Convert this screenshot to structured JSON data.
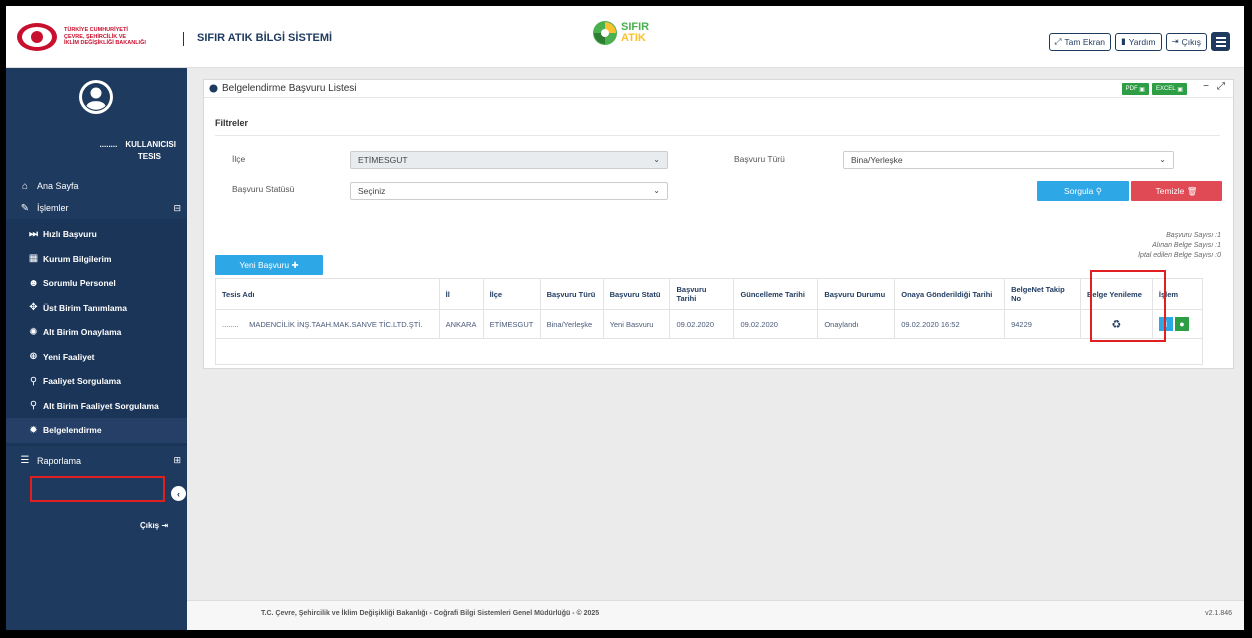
{
  "header": {
    "ministry_lines": [
      "TÜRKİYE CUMHURİYETİ",
      "ÇEVRE, ŞEHİRCİLİK VE",
      "İKLİM DEĞİŞİKLİĞİ BAKANLIĞI"
    ],
    "app_title": "SIFIR ATIK BİLGİ SİSTEMİ",
    "logo_word1": "SIFIR",
    "logo_word2": "ATIK",
    "buttons": {
      "fullscreen": "Tam Ekran",
      "help": "Yardım",
      "logout": "Çıkış"
    }
  },
  "sidebar": {
    "user_dots": "........",
    "user_role": "KULLANICISI",
    "user_tesis": "TESIS",
    "home": "Ana Sayfa",
    "islemler": "İşlemler",
    "sub_items": [
      "Hızlı Başvuru",
      "Kurum Bilgilerim",
      "Sorumlu Personel",
      "Üst Birim Tanımlama",
      "Alt Birim Onaylama",
      "Yeni Faaliyet",
      "Faaliyet Sorgulama",
      "Alt Birim Faaliyet Sorgulama",
      "Belgelendirme"
    ],
    "raporlama": "Raporlama",
    "logout": "Çıkış"
  },
  "panel": {
    "title": "Belgelendirme Başvuru Listesi",
    "export_pdf": "PDF",
    "export_excel": "EXCEL",
    "filters_title": "Filtreler",
    "ilce_label": "İlçe",
    "ilce_value": "ETİMESGUT",
    "basvuru_turu_label": "Başvuru Türü",
    "basvuru_turu_value": "Bina/Yerleşke",
    "basvuru_statusu_label": "Başvuru Statüsü",
    "basvuru_statusu_value": "Seçiniz",
    "sorgula": "Sorgula",
    "temizle": "Temizle",
    "counts": [
      "Başvuru Sayısı :1",
      "Alınan Belge Sayısı :1",
      "İptal edilen Belge Sayısı :0"
    ],
    "new_button": "Yeni Başvuru"
  },
  "table": {
    "headers": [
      "Tesis Adı",
      "İl",
      "İlçe",
      "Başvuru Türü",
      "Başvuru Statü",
      "Başvuru Tarihi",
      "Güncelleme Tarihi",
      "Başvuru Durumu",
      "Onaya Gönderildiği Tarihi",
      "BelgeNet Takip No",
      "Belge Yenileme",
      "İşlem"
    ],
    "row": {
      "tesis_dots": "........",
      "tesis_name": "MADENCİLİK İNŞ.TAAH.MAK.SANVE TİC.LTD.ŞTİ.",
      "il": "ANKARA",
      "ilce": "ETİMESGUT",
      "tur": "Bina/Yerleşke",
      "statu": "Yeni Basvuru",
      "tarih": "09.02.2020",
      "guncelleme": "09.02.2020",
      "durum": "Onaylandı",
      "onaya": "09.02.2020 16:52",
      "takip": "94229"
    }
  },
  "footer": {
    "copyright": "T.C. Çevre, Şehircilik ve İklim Değişikliği Bakanlığı - Coğrafi Bilgi Sistemleri Genel Müdürlüğü - © 2025",
    "version": "v2.1.846"
  },
  "colors": {
    "primary": "#1e3a5f",
    "accent": "#2ea7e6",
    "danger": "#e04a55",
    "success": "#2e9e44",
    "highlight": "#e02020"
  }
}
